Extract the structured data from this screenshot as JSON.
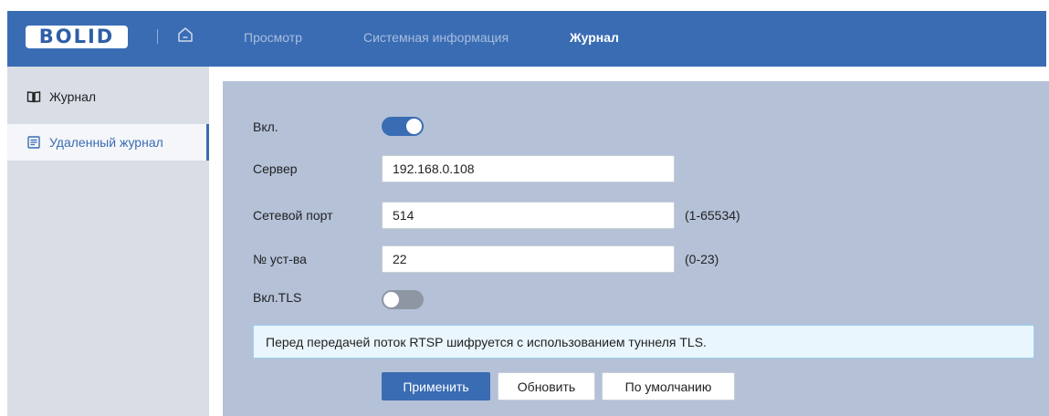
{
  "header": {
    "logo_text": "BOLID",
    "nav": [
      {
        "label": "Просмотр",
        "active": false
      },
      {
        "label": "Системная информация",
        "active": false
      },
      {
        "label": "Журнал",
        "active": true
      }
    ]
  },
  "sidebar": {
    "items": [
      {
        "label": "Журнал",
        "icon": "book-icon",
        "active": false
      },
      {
        "label": "Удаленный журнал",
        "icon": "remote-log-icon",
        "active": true
      }
    ]
  },
  "form": {
    "enable": {
      "label": "Вкл.",
      "state": "on"
    },
    "server": {
      "label": "Сервер",
      "value": "192.168.0.108"
    },
    "port": {
      "label": "Сетевой порт",
      "value": "514",
      "hint": "(1-65534)"
    },
    "device": {
      "label": "№ уст-ва",
      "value": "22",
      "hint": "(0-23)"
    },
    "tls": {
      "label": "Вкл.TLS",
      "state": "off"
    }
  },
  "notice": "Перед передачей поток RTSP шифруется с использованием туннеля TLS.",
  "buttons": {
    "apply": "Применить",
    "refresh": "Обновить",
    "default": "По умолчанию"
  },
  "colors": {
    "accent": "#3a6cb4",
    "content_bg": "#b4c1d7",
    "sidebar_bg": "#d8dde6",
    "notice_bg": "#eaf6fd"
  }
}
